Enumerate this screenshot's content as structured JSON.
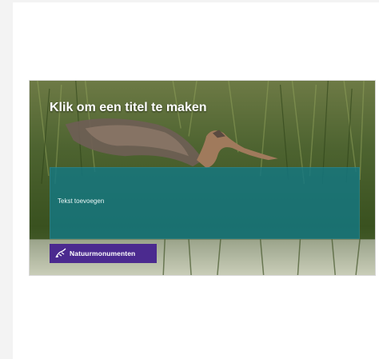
{
  "slide": {
    "title": "Klik om een titel te maken",
    "body_placeholder": "Tekst toevoegen",
    "logo_text": "Natuurmonumenten"
  },
  "colors": {
    "body_box": "#15787f",
    "logo_bg": "#4b2a8f",
    "page_bg": "#f3f3f3"
  },
  "icons": {
    "logo_mark": "natuurmonumenten-logo-icon"
  }
}
